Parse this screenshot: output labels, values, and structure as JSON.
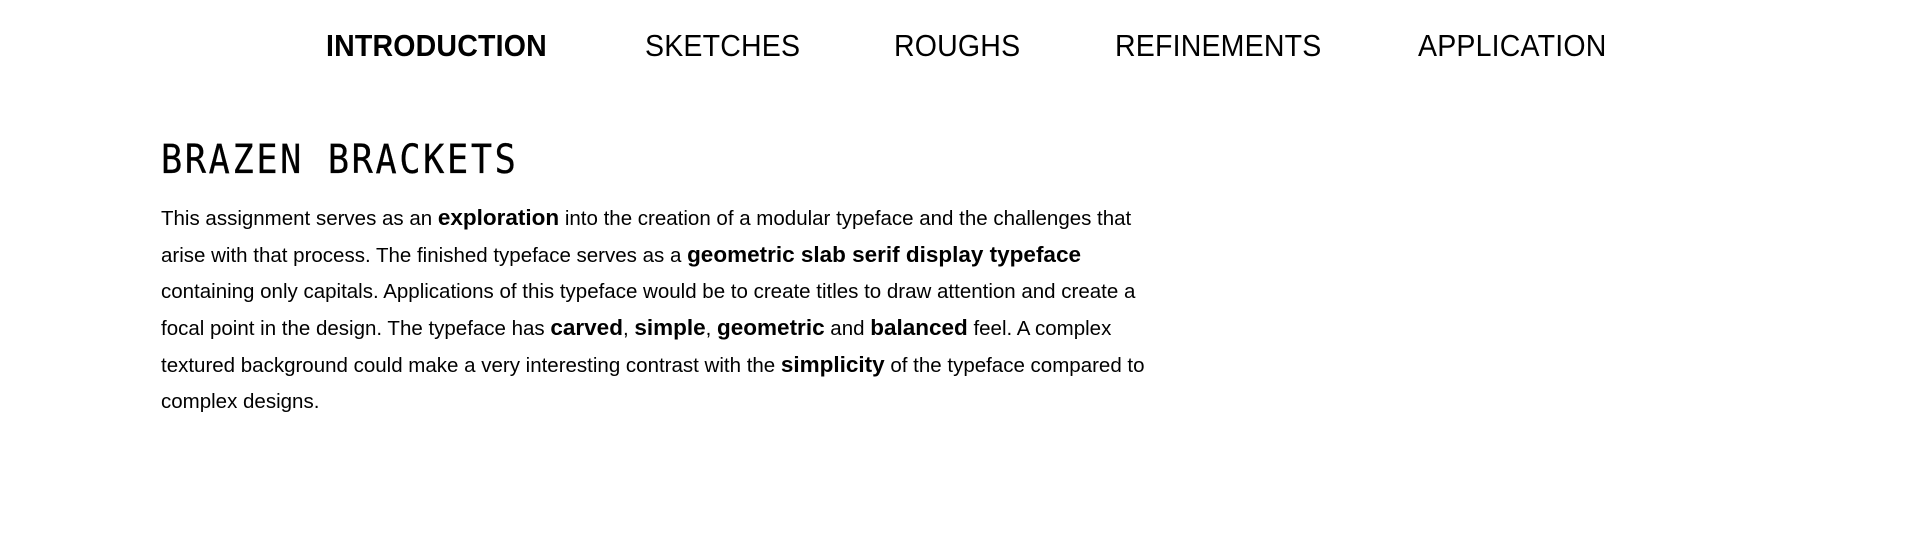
{
  "nav": {
    "items": [
      {
        "label": "INTRODUCTION",
        "active": true
      },
      {
        "label": "SKETCHES",
        "active": false
      },
      {
        "label": "ROUGHS",
        "active": false
      },
      {
        "label": "REFINEMENTS",
        "active": false
      },
      {
        "label": "APPLICATION",
        "active": false
      }
    ]
  },
  "main": {
    "title": "BRAZEN BRACKETS",
    "body": {
      "t1": "This assignment serves as an ",
      "b1": "exploration",
      "t2": " into the creation of a modular typeface and the challenges that arise with that process. The finished typeface serves as a ",
      "b2": "geometric slab serif display typeface",
      "t3": " containing only capitals. Applications of this typeface would be to create titles to draw attention and create a focal point in the design. The typeface has ",
      "b3": "carved",
      "t4": ", ",
      "b4": "simple",
      "t5": ", ",
      "b5": "geometric",
      "t6": " and ",
      "b6": "balanced",
      "t7": " feel. A complex textured background could make a very interesting contrast with the ",
      "b7": "simplicity",
      "t8": " of the typeface compared to complex designs."
    }
  }
}
